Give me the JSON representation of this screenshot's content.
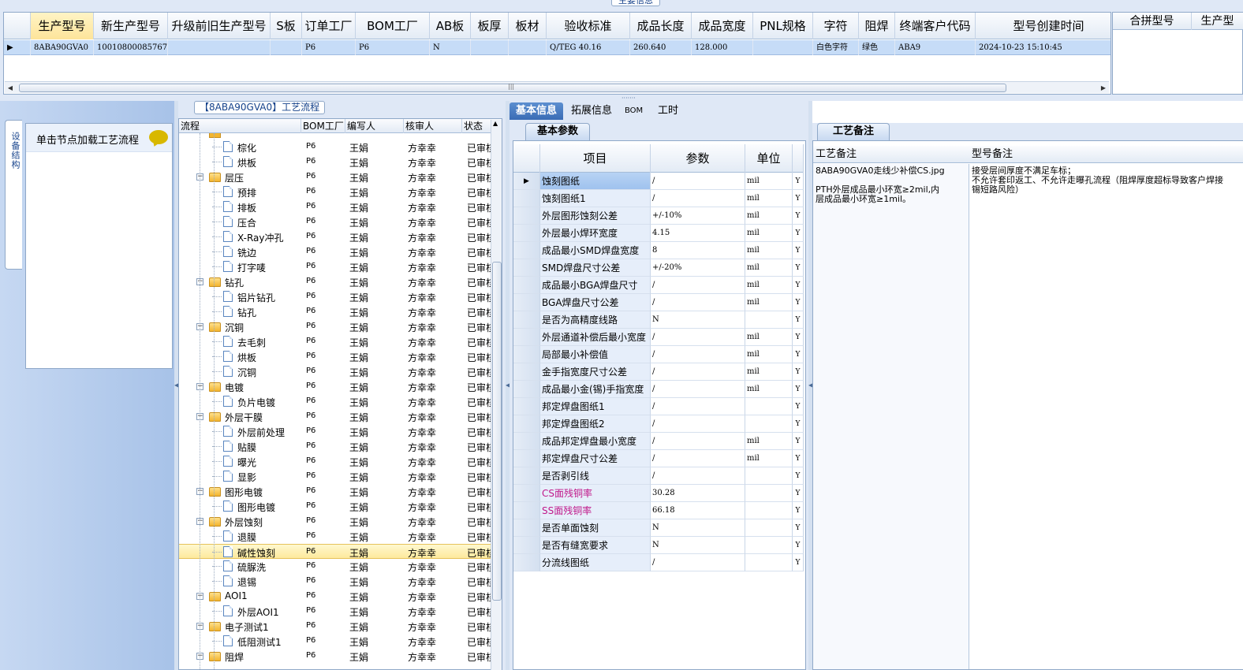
{
  "window": {
    "top_caption": "主要信息"
  },
  "main_grid": {
    "columns": [
      "生产型号",
      "新生产型号",
      "升级前旧生产型号",
      "S板",
      "订单工厂",
      "BOM工厂",
      "AB板",
      "板厚",
      "板材",
      "验收标准",
      "成品长度",
      "成品宽度",
      "PNL规格",
      "字符",
      "阻焊",
      "终端客户代码",
      "型号创建时间"
    ],
    "row": [
      "8ABA90GVA0",
      "10010800085767",
      "",
      "",
      "P6",
      "P6",
      "N",
      "",
      "",
      "Q/TEG 40.16",
      "260.640",
      "128.000",
      "",
      "白色字符",
      "绿色",
      "ABA9",
      "2024-10-23 15:10:45"
    ],
    "row_marker": "▶"
  },
  "side_grid": {
    "columns": [
      "合拼型号",
      "生产型"
    ]
  },
  "left_panel": {
    "vertical_tab": "设备结构",
    "hint": "单击节点加载工艺流程"
  },
  "tree": {
    "caption": "【8ABA90GVA0】工艺流程",
    "columns": [
      "流程",
      "BOM工厂",
      "编写人",
      "核审人",
      "状态"
    ],
    "rows": [
      {
        "level": 1,
        "name": "棕化",
        "bom": "P6",
        "writer": "王娟",
        "reviewer": "方幸幸",
        "status": "已审核"
      },
      {
        "level": 1,
        "name": "烘板",
        "bom": "P6",
        "writer": "王娟",
        "reviewer": "方幸幸",
        "status": "已审核"
      },
      {
        "level": 0,
        "name": "层压",
        "bom": "P6",
        "writer": "王娟",
        "reviewer": "方幸幸",
        "status": "已审核"
      },
      {
        "level": 1,
        "name": "预排",
        "bom": "P6",
        "writer": "王娟",
        "reviewer": "方幸幸",
        "status": "已审核"
      },
      {
        "level": 1,
        "name": "排板",
        "bom": "P6",
        "writer": "王娟",
        "reviewer": "方幸幸",
        "status": "已审核"
      },
      {
        "level": 1,
        "name": "压合",
        "bom": "P6",
        "writer": "王娟",
        "reviewer": "方幸幸",
        "status": "已审核"
      },
      {
        "level": 1,
        "name": "X-Ray冲孔",
        "bom": "P6",
        "writer": "王娟",
        "reviewer": "方幸幸",
        "status": "已审核"
      },
      {
        "level": 1,
        "name": "铣边",
        "bom": "P6",
        "writer": "王娟",
        "reviewer": "方幸幸",
        "status": "已审核"
      },
      {
        "level": 1,
        "name": "打字唛",
        "bom": "P6",
        "writer": "王娟",
        "reviewer": "方幸幸",
        "status": "已审核"
      },
      {
        "level": 0,
        "name": "钻孔",
        "bom": "P6",
        "writer": "王娟",
        "reviewer": "方幸幸",
        "status": "已审核"
      },
      {
        "level": 1,
        "name": "铝片钻孔",
        "bom": "P6",
        "writer": "王娟",
        "reviewer": "方幸幸",
        "status": "已审核"
      },
      {
        "level": 1,
        "name": "钻孔",
        "bom": "P6",
        "writer": "王娟",
        "reviewer": "方幸幸",
        "status": "已审核"
      },
      {
        "level": 0,
        "name": "沉铜",
        "bom": "P6",
        "writer": "王娟",
        "reviewer": "方幸幸",
        "status": "已审核"
      },
      {
        "level": 1,
        "name": "去毛刺",
        "bom": "P6",
        "writer": "王娟",
        "reviewer": "方幸幸",
        "status": "已审核"
      },
      {
        "level": 1,
        "name": "烘板",
        "bom": "P6",
        "writer": "王娟",
        "reviewer": "方幸幸",
        "status": "已审核"
      },
      {
        "level": 1,
        "name": "沉铜",
        "bom": "P6",
        "writer": "王娟",
        "reviewer": "方幸幸",
        "status": "已审核"
      },
      {
        "level": 0,
        "name": "电镀",
        "bom": "P6",
        "writer": "王娟",
        "reviewer": "方幸幸",
        "status": "已审核"
      },
      {
        "level": 1,
        "name": "负片电镀",
        "bom": "P6",
        "writer": "王娟",
        "reviewer": "方幸幸",
        "status": "已审核"
      },
      {
        "level": 0,
        "name": "外层干膜",
        "bom": "P6",
        "writer": "王娟",
        "reviewer": "方幸幸",
        "status": "已审核"
      },
      {
        "level": 1,
        "name": "外层前处理",
        "bom": "P6",
        "writer": "王娟",
        "reviewer": "方幸幸",
        "status": "已审核"
      },
      {
        "level": 1,
        "name": "贴膜",
        "bom": "P6",
        "writer": "王娟",
        "reviewer": "方幸幸",
        "status": "已审核"
      },
      {
        "level": 1,
        "name": "曝光",
        "bom": "P6",
        "writer": "王娟",
        "reviewer": "方幸幸",
        "status": "已审核"
      },
      {
        "level": 1,
        "name": "显影",
        "bom": "P6",
        "writer": "王娟",
        "reviewer": "方幸幸",
        "status": "已审核"
      },
      {
        "level": 0,
        "name": "图形电镀",
        "bom": "P6",
        "writer": "王娟",
        "reviewer": "方幸幸",
        "status": "已审核"
      },
      {
        "level": 1,
        "name": "图形电镀",
        "bom": "P6",
        "writer": "王娟",
        "reviewer": "方幸幸",
        "status": "已审核"
      },
      {
        "level": 0,
        "name": "外层蚀刻",
        "bom": "P6",
        "writer": "王娟",
        "reviewer": "方幸幸",
        "status": "已审核"
      },
      {
        "level": 1,
        "name": "退膜",
        "bom": "P6",
        "writer": "王娟",
        "reviewer": "方幸幸",
        "status": "已审核"
      },
      {
        "level": 1,
        "name": "碱性蚀刻",
        "bom": "P6",
        "writer": "王娟",
        "reviewer": "方幸幸",
        "status": "已审核",
        "selected": true
      },
      {
        "level": 1,
        "name": "硫脲洗",
        "bom": "P6",
        "writer": "王娟",
        "reviewer": "方幸幸",
        "status": "已审核"
      },
      {
        "level": 1,
        "name": "退锡",
        "bom": "P6",
        "writer": "王娟",
        "reviewer": "方幸幸",
        "status": "已审核"
      },
      {
        "level": 0,
        "name": "AOI1",
        "bom": "P6",
        "writer": "王娟",
        "reviewer": "方幸幸",
        "status": "已审核"
      },
      {
        "level": 1,
        "name": "外层AOI1",
        "bom": "P6",
        "writer": "王娟",
        "reviewer": "方幸幸",
        "status": "已审核"
      },
      {
        "level": 0,
        "name": "电子测试1",
        "bom": "P6",
        "writer": "王娟",
        "reviewer": "方幸幸",
        "status": "已审核"
      },
      {
        "level": 1,
        "name": "低阻测试1",
        "bom": "P6",
        "writer": "王娟",
        "reviewer": "方幸幸",
        "status": "已审核"
      },
      {
        "level": 0,
        "name": "阻焊",
        "bom": "P6",
        "writer": "王娟",
        "reviewer": "方幸幸",
        "status": "已审核"
      }
    ]
  },
  "tabs": [
    "基本信息",
    "拓展信息",
    "BOM",
    "工时"
  ],
  "params": {
    "subtab": "基本参数",
    "columns": [
      "项目",
      "参数",
      "单位"
    ],
    "rows": [
      {
        "item": "蚀刻图纸",
        "value": "/",
        "unit": "mil",
        "yn": "Y",
        "selected": true
      },
      {
        "item": "蚀刻图纸1",
        "value": "/",
        "unit": "mil",
        "yn": "Y"
      },
      {
        "item": "外层图形蚀刻公差",
        "value": "+/-10%",
        "unit": "mil",
        "yn": "Y"
      },
      {
        "item": "外层最小焊环宽度",
        "value": "4.15",
        "unit": "mil",
        "yn": "Y"
      },
      {
        "item": "成品最小SMD焊盘宽度",
        "value": "8",
        "unit": "mil",
        "yn": "Y"
      },
      {
        "item": "SMD焊盘尺寸公差",
        "value": "+/-20%",
        "unit": "mil",
        "yn": "Y"
      },
      {
        "item": "成品最小BGA焊盘尺寸",
        "value": "/",
        "unit": "mil",
        "yn": "Y"
      },
      {
        "item": "BGA焊盘尺寸公差",
        "value": "/",
        "unit": "mil",
        "yn": "Y"
      },
      {
        "item": "是否为高精度线路",
        "value": "N",
        "unit": "",
        "yn": "Y"
      },
      {
        "item": "外层通道补偿后最小宽度",
        "value": "/",
        "unit": "mil",
        "yn": "Y"
      },
      {
        "item": "局部最小补偿值",
        "value": "/",
        "unit": "mil",
        "yn": "Y"
      },
      {
        "item": "金手指宽度尺寸公差",
        "value": "/",
        "unit": "mil",
        "yn": "Y"
      },
      {
        "item": "成品最小金(锡)手指宽度",
        "value": "/",
        "unit": "mil",
        "yn": "Y"
      },
      {
        "item": "邦定焊盘图纸1",
        "value": "/",
        "unit": "",
        "yn": "Y"
      },
      {
        "item": "邦定焊盘图纸2",
        "value": "/",
        "unit": "",
        "yn": "Y"
      },
      {
        "item": "成品邦定焊盘最小宽度",
        "value": "/",
        "unit": "mil",
        "yn": "Y"
      },
      {
        "item": "邦定焊盘尺寸公差",
        "value": "/",
        "unit": "mil",
        "yn": "Y"
      },
      {
        "item": "是否剥引线",
        "value": "/",
        "unit": "",
        "yn": "Y"
      },
      {
        "item": "CS面残铜率",
        "value": "30.28",
        "unit": "",
        "yn": "Y",
        "pink": true
      },
      {
        "item": "SS面残铜率",
        "value": "66.18",
        "unit": "",
        "yn": "Y",
        "pink": true
      },
      {
        "item": "是否单面蚀刻",
        "value": "N",
        "unit": "",
        "yn": "Y"
      },
      {
        "item": "是否有缝宽要求",
        "value": "N",
        "unit": "",
        "yn": "Y"
      },
      {
        "item": "分流线图纸",
        "value": "/",
        "unit": "",
        "yn": "Y"
      }
    ]
  },
  "notes": {
    "tab": "工艺备注",
    "col1_title": "工艺备注",
    "col2_title": "型号备注",
    "col1_text": "8ABA90GVA0走线少补偿CS.jpg\n\nPTH外层成品最小环宽≥2mil,内\n层成品最小环宽≥1mil。",
    "col2_text": "接受层间厚度不满足车标；\n不允许套印返工、不允许走曝孔流程（阻焊厚度超标导致客户焊接\n锡短路风险）"
  },
  "colors": {
    "accent": "#3a6cb5",
    "selected_row": "#c6dcf7",
    "highlight": "#fde99c",
    "pink_text": "#c0188a"
  }
}
